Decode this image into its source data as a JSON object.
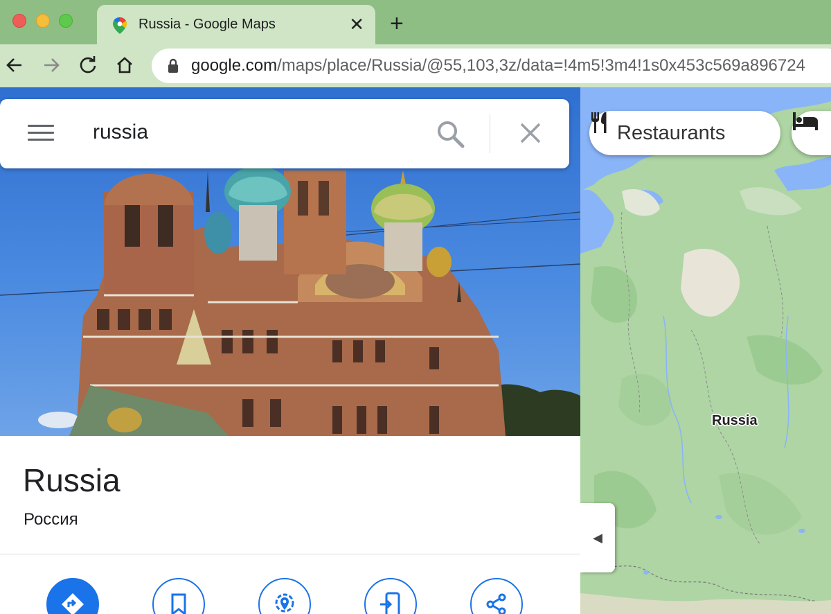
{
  "browser": {
    "tab": {
      "title": "Russia - Google Maps",
      "favicon": "google-maps-pin",
      "close_glyph": "✕"
    },
    "new_tab_glyph": "+",
    "toolbar": {
      "back_icon": "arrow-left",
      "forward_icon": "arrow-right",
      "reload_icon": "reload",
      "home_icon": "home"
    },
    "address_bar": {
      "domain": "google.com",
      "path": "/maps/place/Russia/@55,103,3z/data=!4m5!3m4!1s0x453c569a896724"
    }
  },
  "search": {
    "query": "russia",
    "menu_icon": "hamburger",
    "search_icon": "magnifier",
    "clear_glyph": "✕"
  },
  "place": {
    "name": "Russia",
    "native_name": "Россия",
    "photo_subject": "cathedral"
  },
  "actions": [
    {
      "id": "directions",
      "icon": "directions-arrow",
      "primary": true
    },
    {
      "id": "save",
      "icon": "bookmark"
    },
    {
      "id": "nearby",
      "icon": "nearby-pin"
    },
    {
      "id": "send-to-phone",
      "icon": "send-to-phone"
    },
    {
      "id": "share",
      "icon": "share"
    }
  ],
  "map": {
    "label": "Russia",
    "chips": [
      {
        "label": "Restaurants",
        "icon": "fork-knife"
      },
      {
        "label": "",
        "icon": "hotel-bed"
      }
    ],
    "collapse_glyph": "◀",
    "colors": {
      "land": "#aed5a3",
      "water": "#8ab4f8",
      "tundra": "#e8e4d8"
    }
  }
}
